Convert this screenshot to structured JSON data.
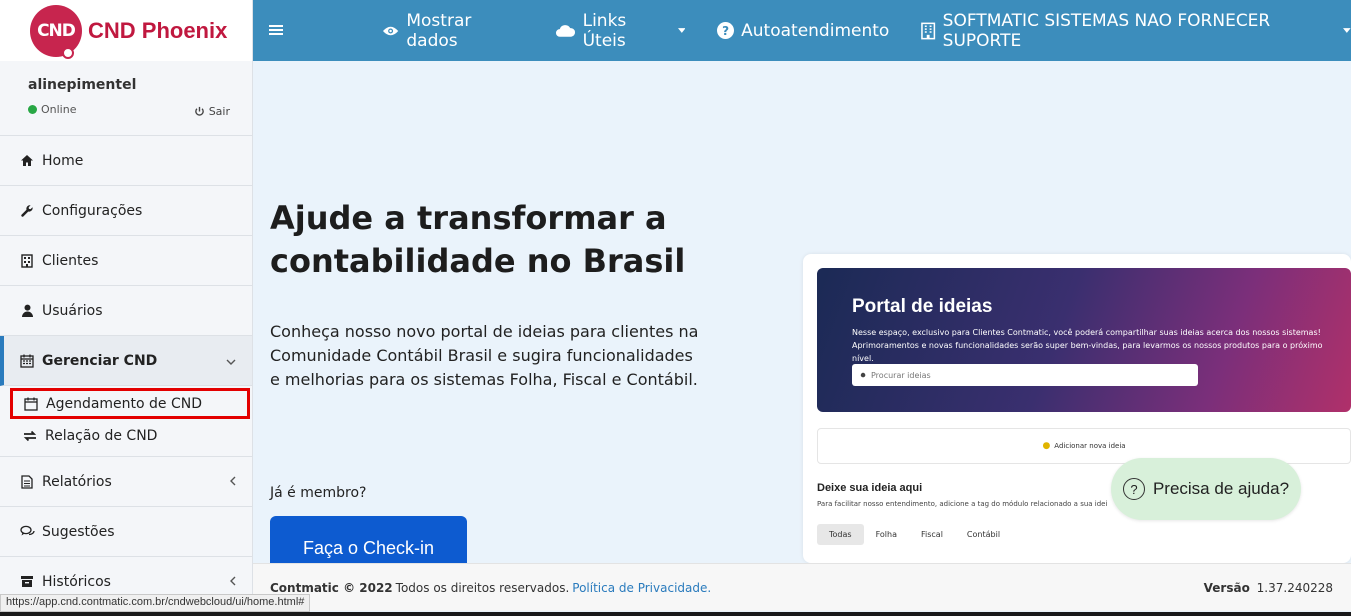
{
  "brand": {
    "logo_text": "CND",
    "name": "CND Phoenix"
  },
  "user": {
    "name": "alinepimentel",
    "status": "Online",
    "logout": "Sair"
  },
  "sidebar": {
    "items": [
      {
        "label": "Home",
        "icon": "home-icon"
      },
      {
        "label": "Configurações",
        "icon": "wrench-icon"
      },
      {
        "label": "Clientes",
        "icon": "building-icon"
      },
      {
        "label": "Usuários",
        "icon": "user-icon"
      },
      {
        "label": "Gerenciar CND",
        "icon": "calendar-icon"
      },
      {
        "label": "Relatórios",
        "icon": "document-icon"
      },
      {
        "label": "Sugestões",
        "icon": "chat-icon"
      },
      {
        "label": "Históricos",
        "icon": "archive-icon"
      }
    ],
    "subitems": [
      {
        "label": "Agendamento de CND",
        "icon": "calendar-icon"
      },
      {
        "label": "Relação de CND",
        "icon": "swap-icon"
      }
    ]
  },
  "topbar": {
    "show_data": "Mostrar dados",
    "links": "Links Úteis",
    "self_service": "Autoatendimento",
    "company": "SOFTMATIC SISTEMAS NAO FORNECER SUPORTE"
  },
  "hero": {
    "title": "Ajude a transformar a contabilidade no Brasil",
    "text_1": "Conheça nosso novo portal de ideias para clientes na Comunidade Contábil Brasil e sugira funcionalidades",
    "text_2": "e melhorias para os sistemas Folha, Fiscal e Contábil.",
    "member_question": "Já é membro?",
    "checkin_button": "Faça o Check-in"
  },
  "portal": {
    "title": "Portal de ideias",
    "description": "Nesse espaço, exclusivo para Clientes Contmatic, você poderá compartilhar suas ideias acerca dos nossos sistemas! Aprimoramentos e novas funcionalidades serão super bem-vindas, para levarmos os nossos produtos para o próximo nível.",
    "search_placeholder": "Procurar ideias",
    "add_idea": "Adicionar nova ideia",
    "leave_title": "Deixe sua ideia aqui",
    "leave_desc": "Para facilitar nosso entendimento, adicione a tag do módulo relacionado a sua ideia: Mó",
    "filters": [
      "Todas",
      "Folha",
      "Fiscal",
      "Contábil"
    ]
  },
  "help_button": "Precisa de ajuda?",
  "footer": {
    "copyright_bold": "Contmatic © 2022",
    "rights": "Todos os direitos reservados.",
    "privacy": "Política de Privacidade.",
    "version_label": "Versão",
    "version_value": "1.37.240228"
  },
  "status_url": "https://app.cnd.contmatic.com.br/cndwebcloud/ui/home.html#",
  "colors": {
    "topbar": "#3c8dbc",
    "brand": "#c0183f",
    "checkin": "#0d5bd0",
    "highlight": "#e30000",
    "help_bg": "#d8f0da"
  }
}
